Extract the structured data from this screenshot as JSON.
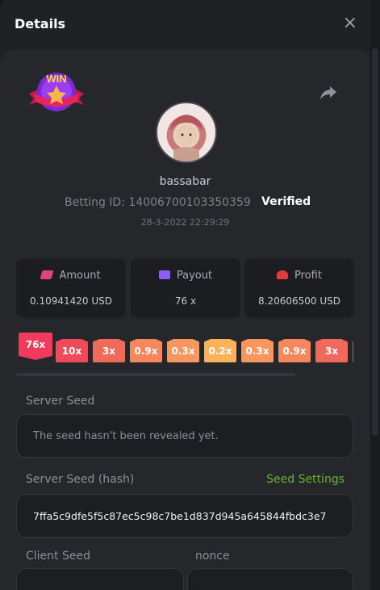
{
  "modal": {
    "title": "Details",
    "close_glyph": "×"
  },
  "player": {
    "username": "bassabar",
    "betting_id_label": "Betting ID:",
    "betting_id": "14006700103350359",
    "verified_label": "Verified",
    "datetime": "28-3-2022 22:29:29"
  },
  "badge": {
    "text": "WIN"
  },
  "stats": [
    {
      "label": "Amount",
      "value": "0.10941420 USD",
      "icon": "wallet-icon",
      "color": "#e0447a"
    },
    {
      "label": "Payout",
      "value": "76 x",
      "icon": "card-icon",
      "color": "#8c5cf5"
    },
    {
      "label": "Profit",
      "value": "8.20606500 USD",
      "icon": "hand-coin-icon",
      "color": "#e33a3a"
    }
  ],
  "multipliers": [
    {
      "text": "76x",
      "color": "#f23b5c"
    },
    {
      "text": "10x",
      "color": "#f04a5a"
    },
    {
      "text": "3x",
      "color": "#f06a5c"
    },
    {
      "text": "0.9x",
      "color": "#f6875c"
    },
    {
      "text": "0.3x",
      "color": "#f7965e"
    },
    {
      "text": "0.2x",
      "color": "#fbb25b"
    },
    {
      "text": "0.3x",
      "color": "#f7965e"
    },
    {
      "text": "0.9x",
      "color": "#f6875c"
    },
    {
      "text": "3x",
      "color": "#f06a5c"
    }
  ],
  "server_seed": {
    "label": "Server Seed",
    "value": "The seed hasn't been revealed yet."
  },
  "server_seed_hash": {
    "label": "Server Seed (hash)",
    "settings_link": "Seed Settings",
    "value": "7ffa5c9dfe5f5c87ec5c98c7be1d837d945a645844fbdc3e7"
  },
  "client_seed": {
    "label": "Client Seed"
  },
  "nonce": {
    "label": "nonce"
  },
  "colors": {
    "panel": "#25272b",
    "accent_green": "#6ab42d"
  }
}
